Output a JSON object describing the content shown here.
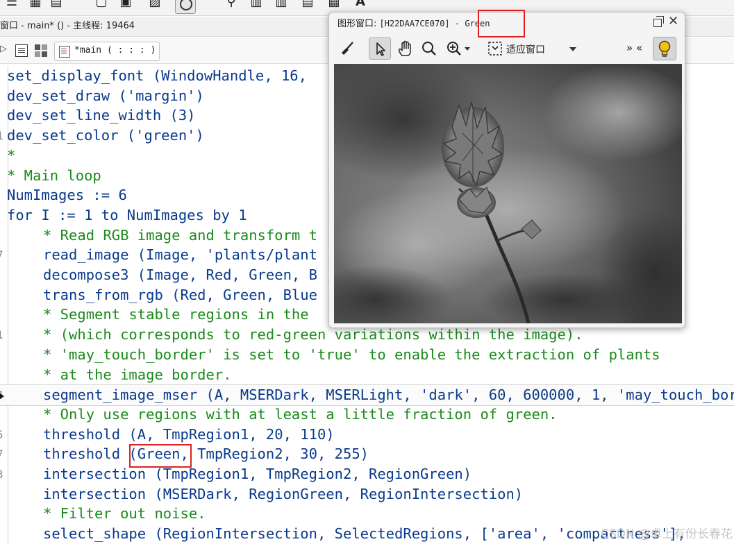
{
  "top_toolbar": {
    "icons": [
      "list-icon",
      "grid-icon",
      "document-icon",
      "image-icon",
      "circle-tool-icon",
      "zoom-icon",
      "chart-icon",
      "chart-plus-icon",
      "stack-icon",
      "font-icon"
    ]
  },
  "title_bar": {
    "text": "窗口 - main* () - 主线程: 19464"
  },
  "tab_row": {
    "tab_label": "*main ( : : : )"
  },
  "code": {
    "lines": [
      {
        "num": "",
        "text": "set_display_font (WindowHandle, 16,",
        "kind": "code",
        "indent": false
      },
      {
        "num": "",
        "text": "dev_set_draw ('margin')",
        "kind": "code",
        "indent": false
      },
      {
        "num": "",
        "text": "dev_set_line_width (3)",
        "kind": "code",
        "indent": false
      },
      {
        "num": "1",
        "text": "dev_set_color ('green')",
        "kind": "code",
        "indent": false
      },
      {
        "num": "",
        "text": "*",
        "kind": "comment",
        "indent": false
      },
      {
        "num": "",
        "text": "* Main loop",
        "kind": "comment",
        "indent": false
      },
      {
        "num": "",
        "text": "NumImages := 6",
        "kind": "code",
        "indent": false
      },
      {
        "num": "",
        "text": "for I := 1 to NumImages by 1",
        "kind": "code",
        "indent": false
      },
      {
        "num": "",
        "text": "* Read RGB image and transform t",
        "kind": "comment",
        "indent": true
      },
      {
        "num": "7",
        "text": "read_image (Image, 'plants/plant",
        "kind": "code",
        "indent": true
      },
      {
        "num": "",
        "text": "decompose3 (Image, Red, Green, B",
        "kind": "code",
        "indent": true
      },
      {
        "num": "",
        "text": "trans_from_rgb (Red, Green, Blue",
        "kind": "code",
        "indent": true
      },
      {
        "num": "",
        "text": "* Segment stable regions in the",
        "kind": "comment",
        "indent": true
      },
      {
        "num": "1",
        "text": "* (which corresponds to red-green variations within the image).",
        "kind": "comment",
        "indent": true
      },
      {
        "num": "",
        "text": "* 'may_touch_border' is set to 'true' to enable the extraction of plants",
        "kind": "comment",
        "indent": true
      },
      {
        "num": "",
        "text": "* at the image border.",
        "kind": "comment",
        "indent": true
      },
      {
        "num": "4",
        "text": "segment_image_mser (A, MSERDark, MSERLight, 'dark', 60, 600000, 1, 'may_touch_border'",
        "kind": "code",
        "indent": true
      },
      {
        "num": "",
        "text": "* Only use regions with at least a little fraction of green.",
        "kind": "comment",
        "indent": true
      },
      {
        "num": "5",
        "text": "threshold (A, TmpRegion1, 20, 110)",
        "kind": "code",
        "indent": true
      },
      {
        "num": "7",
        "text": "threshold (Green, TmpRegion2, 30, 255)",
        "kind": "code",
        "indent": true
      },
      {
        "num": "3",
        "text": "intersection (TmpRegion1, TmpRegion2, RegionGreen)",
        "kind": "code",
        "indent": true
      },
      {
        "num": "",
        "text": "intersection (MSERDark, RegionGreen, RegionIntersection)",
        "kind": "code",
        "indent": true
      },
      {
        "num": "",
        "text": "* Filter out noise.",
        "kind": "comment",
        "indent": true
      },
      {
        "num": "",
        "text": "select_shape (RegionIntersection, SelectedRegions, ['area', 'compactness'],",
        "kind": "code",
        "indent": true
      }
    ]
  },
  "graphics_window": {
    "title_prefix": "图形窗口: ",
    "handle": "[H22DAA7CE070]",
    "separator": " - ",
    "channel_name": "Green",
    "toolbar": {
      "fit_label": "适应窗口",
      "more_label": "» «"
    }
  },
  "watermark": "CSDN @卓上有份长春花",
  "colors": {
    "code_blue": "#0a3a8c",
    "comment_green": "#1a8a1a",
    "highlight_red": "#e02020"
  }
}
